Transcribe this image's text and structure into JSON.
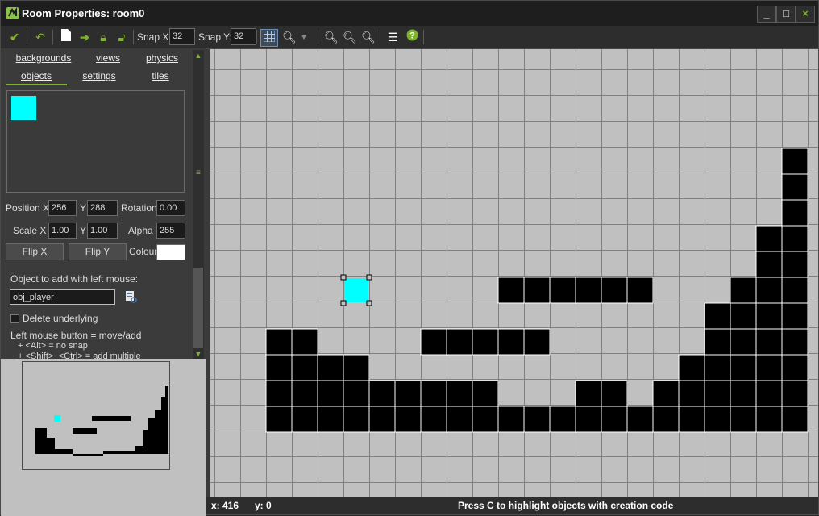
{
  "window": {
    "title": "Room Properties: room0",
    "minimize_label": "_",
    "maximize_label": "□",
    "close_label": "×"
  },
  "toolbar": {
    "snap_x_label": "Snap X:",
    "snap_x_value": "32",
    "snap_y_label": "Snap Y:",
    "snap_y_value": "32",
    "icons": [
      "checkmark-icon",
      "undo-icon",
      "new-page-icon",
      "arrow-right-icon",
      "lock-icon",
      "unlock-icon",
      "grid-icon",
      "zoom-dropdown-icon",
      "zoom-out-icon",
      "zoom-in-icon",
      "zoom-reset-icon",
      "list-icon",
      "help-icon"
    ]
  },
  "tabs": {
    "row1": [
      "backgrounds",
      "views",
      "physics"
    ],
    "row2": [
      "objects",
      "settings",
      "tiles"
    ],
    "active": "objects"
  },
  "object_panel": {
    "position_label": "Position X",
    "pos_x": "256",
    "y_label": "Y",
    "pos_y": "288",
    "rotation_label": "Rotation",
    "rotation": "0.00",
    "scale_label": "Scale X",
    "scale_x": "1.00",
    "scale_y_label": "Y",
    "scale_y": "1.00",
    "alpha_label": "Alpha",
    "alpha": "255",
    "flip_x": "Flip X",
    "flip_y": "Flip Y",
    "colour_label": "Colour",
    "colour_value": "#ffffff",
    "add_object_label": "Object to add with left mouse:",
    "object_name": "obj_player",
    "delete_underlying_label": "Delete underlying",
    "help_line1": "Left mouse button = move/add",
    "help_line2": "+ <Alt> = no snap",
    "help_line3": "+ <Shift>+<Ctrl> = add multiple"
  },
  "room": {
    "grid_color": "#808080",
    "background_color": "#c0c0c0",
    "wall_color": "#000000",
    "player_color": "#00ffff"
  },
  "status": {
    "x_label": "x: 416",
    "y_label": "y: 0",
    "message": "Press C to highlight objects with creation code"
  }
}
